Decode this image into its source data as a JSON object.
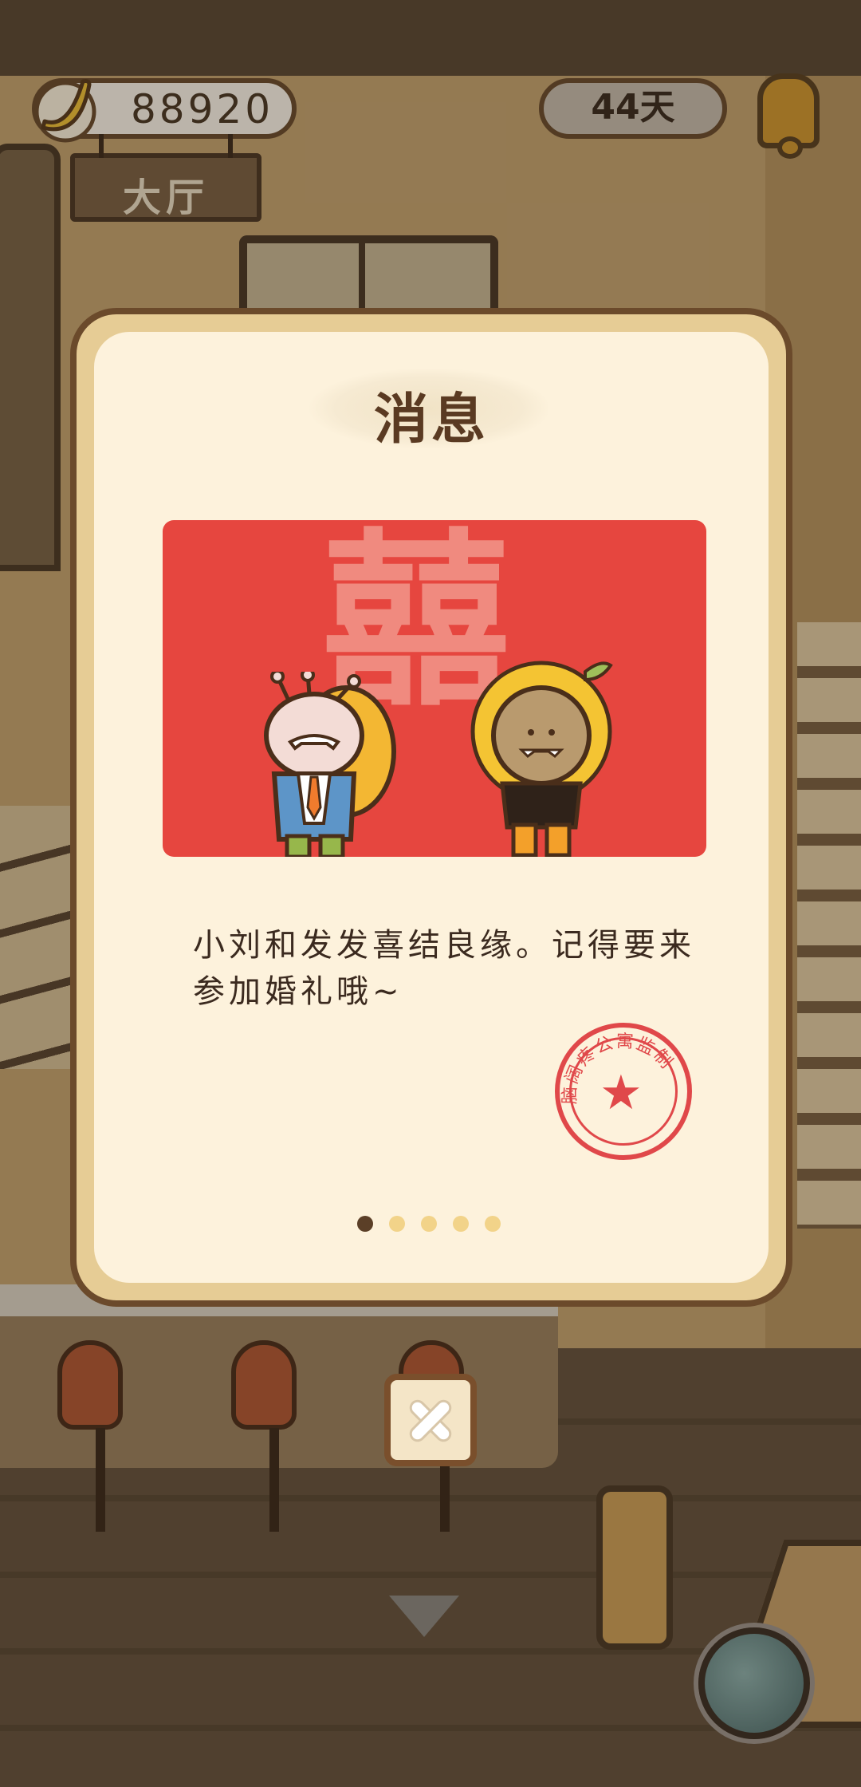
{
  "hud": {
    "bananas": "88920",
    "room": "大厅",
    "days": "44天"
  },
  "dialog": {
    "title": "消息",
    "card_char": "囍",
    "message": "小刘和发发喜结良缘。记得要来参加婚礼哦~",
    "stamp_text": "脑阔疼公寓监制",
    "page_count": 5,
    "current_page": 1
  },
  "colors": {
    "card_red": "#e6463f",
    "stamp_red": "#e0484a",
    "dialog_frame": "#e6cc95",
    "dialog_inner": "#fdf2dc",
    "dot_active": "#5b3f27",
    "dot_inactive": "#f2d389"
  },
  "icons": [
    "banana-icon",
    "bell-icon",
    "close-icon",
    "down-arrow-icon",
    "yarn-ball-icon"
  ]
}
